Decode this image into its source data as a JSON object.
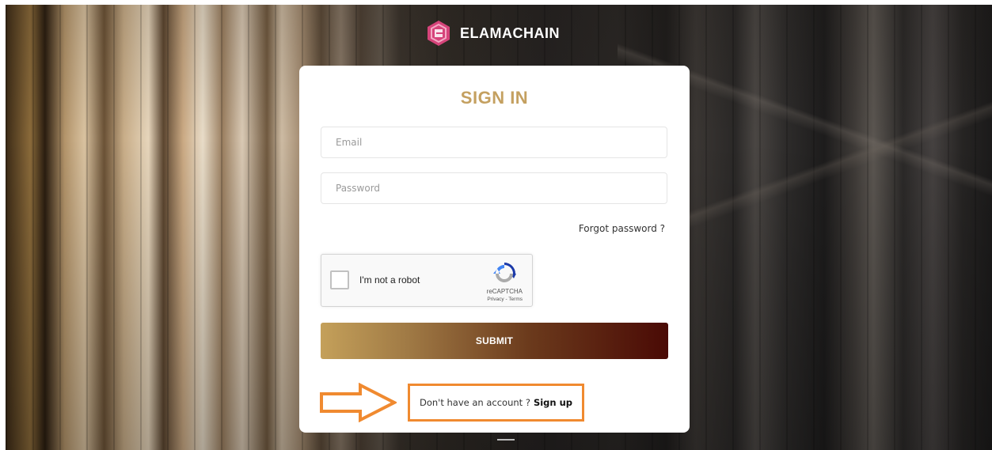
{
  "brand": {
    "name": "ELAMACHAIN",
    "logo_icon": "elamachain-hexagon-logo-icon",
    "logo_color": "#d6447a"
  },
  "signin": {
    "title": "SIGN IN",
    "title_color": "#c4a060",
    "email": {
      "placeholder": "Email",
      "value": ""
    },
    "password": {
      "placeholder": "Password",
      "value": ""
    },
    "forgot_label": "Forgot password ?",
    "captcha": {
      "label": "I'm not a robot",
      "brand": "reCAPTCHA",
      "links": "Privacy - Terms",
      "checked": false,
      "icon": "recaptcha-icon"
    },
    "submit_label": "SUBMIT",
    "submit_gradient": [
      "#c4a05a",
      "#4a0a05"
    ],
    "signup_prompt": "Don't have an account ?",
    "signup_link": "Sign up"
  },
  "annotation": {
    "color": "#f08a30",
    "arrow_icon": "right-arrow-outline-icon"
  }
}
